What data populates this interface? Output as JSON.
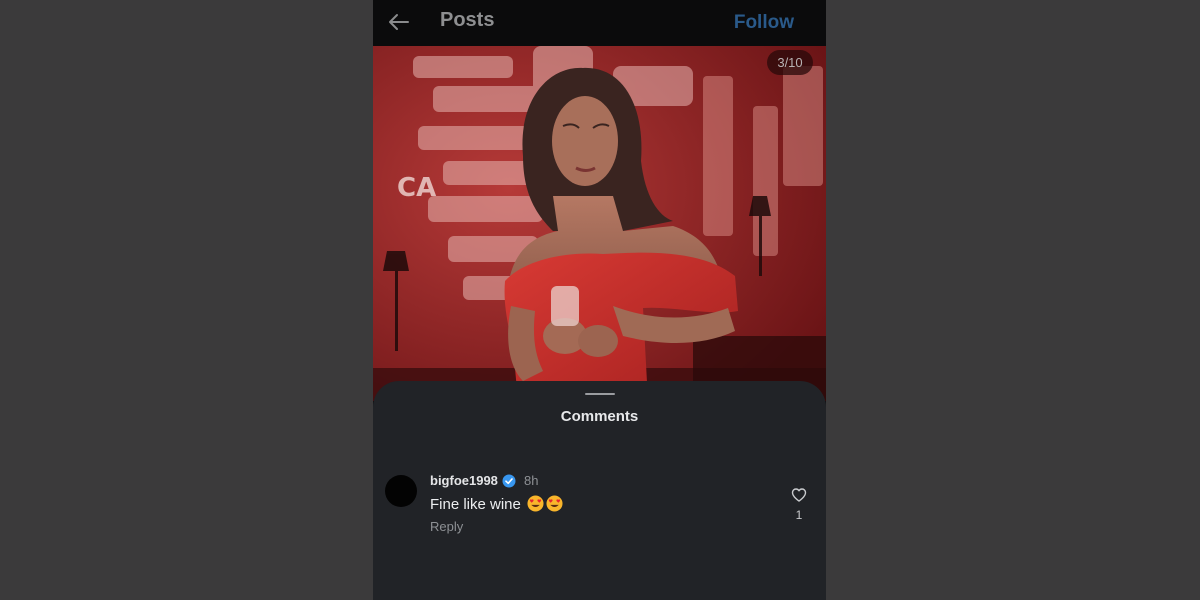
{
  "header": {
    "title": "Posts",
    "follow_label": "Follow",
    "back_icon": "arrow-left-icon"
  },
  "post": {
    "image_counter": "3/10",
    "image_index": 3,
    "image_total": 10,
    "image_description_colors": {
      "background": "#7c1b1d",
      "dress": "#c8302c",
      "skin": "#a06a55",
      "hair": "#3a2420"
    }
  },
  "comments_sheet": {
    "title": "Comments",
    "comments": [
      {
        "username": "bigfoe1998",
        "verified": true,
        "time": "8h",
        "text": "Fine like wine",
        "emojis": [
          "heart-eyes-emoji",
          "heart-eyes-emoji"
        ],
        "reply_label": "Reply",
        "like_count": "1"
      }
    ]
  },
  "colors": {
    "page_background": "#3b3a3b",
    "sheet_background": "#212327",
    "follow_blue": "#2a5a8a",
    "verified_blue": "#3897f0"
  }
}
